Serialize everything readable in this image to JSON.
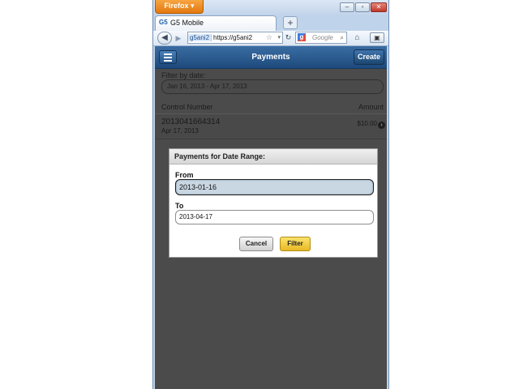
{
  "browser": {
    "firefox_button_label": "Firefox ▾",
    "window_controls": {
      "minimize": "–",
      "maximize": "▫",
      "close": "✕"
    },
    "tab": {
      "favicon_text": "G5",
      "title": "G5 Mobile"
    },
    "new_tab_label": "+",
    "nav": {
      "back_icon": "◀",
      "forward_icon": "▶",
      "site_identity": "g5ani2",
      "url": "https://g5ani2",
      "star_icon": "☆",
      "dropdown_icon": "▾",
      "reload_icon": "↻",
      "search_engine_letter": "g",
      "search_placeholder": "Google",
      "search_icon": "⌕",
      "home_icon": "⌂",
      "addon_icon": "▣"
    }
  },
  "app": {
    "title": "Payments",
    "create_label": "Create",
    "filter_label": "Filter by date:",
    "filter_value": "Jan 16, 2013 - Apr 17, 2013",
    "list_headers": {
      "control_number": "Control Number",
      "amount": "Amount"
    },
    "payments": [
      {
        "control_number": "2013041664314",
        "date": "Apr 17, 2013",
        "amount": "$10.00"
      }
    ],
    "row_chevron": "›"
  },
  "dialog": {
    "title": "Payments for Date Range:",
    "from_label": "From",
    "from_value": "2013-01-16",
    "to_label": "To",
    "to_value": "2013-04-17",
    "cancel_label": "Cancel",
    "filter_label": "Filter"
  }
}
